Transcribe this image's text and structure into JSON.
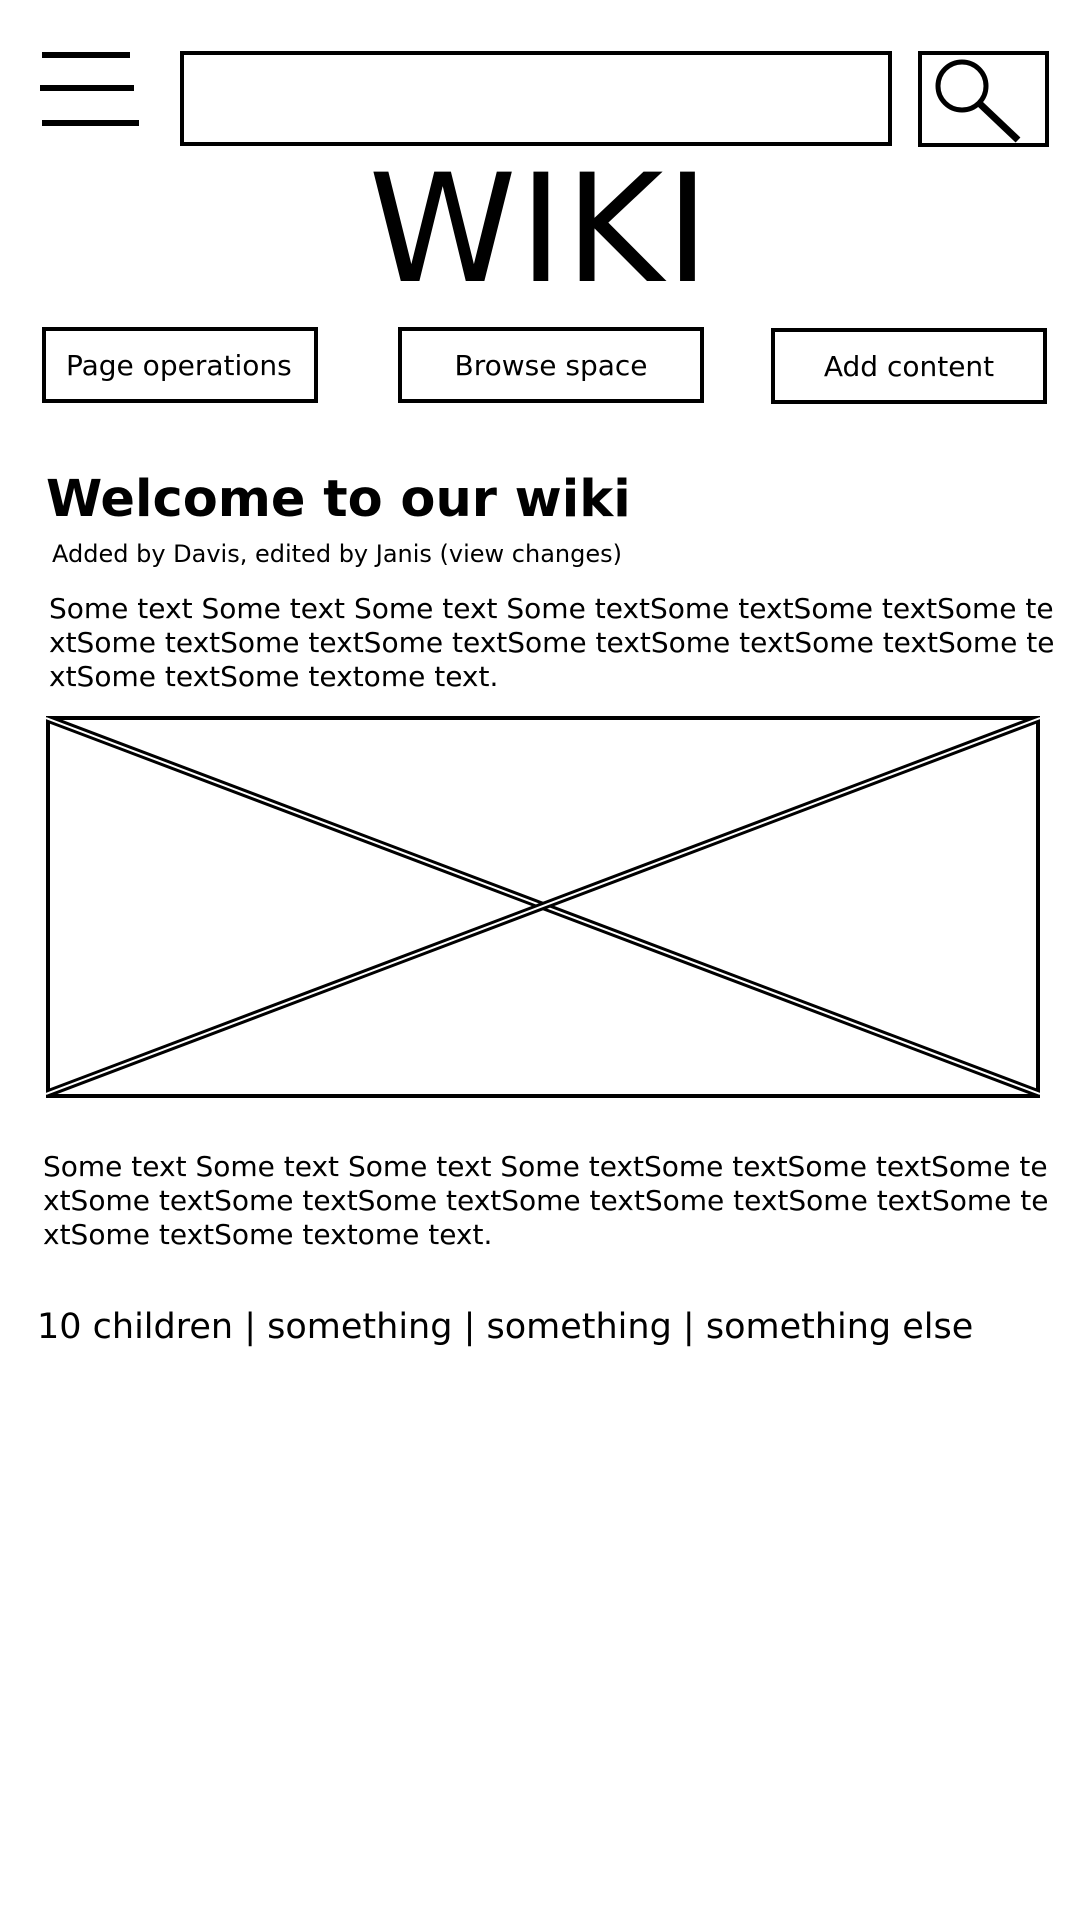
{
  "header": {
    "menu_icon": "hamburger-menu-icon",
    "search": {
      "value": "",
      "placeholder": ""
    },
    "search_icon": "magnifier-icon",
    "logo_text": "WIKI"
  },
  "nav": {
    "page_operations": "Page operations",
    "browse_space": "Browse space",
    "add_content": "Add content"
  },
  "article": {
    "title": "Welcome to our wiki",
    "byline": "Added by Davis, edited by Janis (view changes)",
    "paragraph_1": "Some text Some text Some text Some textSome textSome textSome textSome textSome textSome textSome textSome textSome textSome textSome textSome textome text.",
    "image_icon": "image-placeholder-icon",
    "paragraph_2": "Some text Some text Some text Some textSome textSome textSome textSome textSome textSome textSome textSome textSome textSome textSome textSome textome text.",
    "footer_links": "10 children | something | something | something else"
  }
}
